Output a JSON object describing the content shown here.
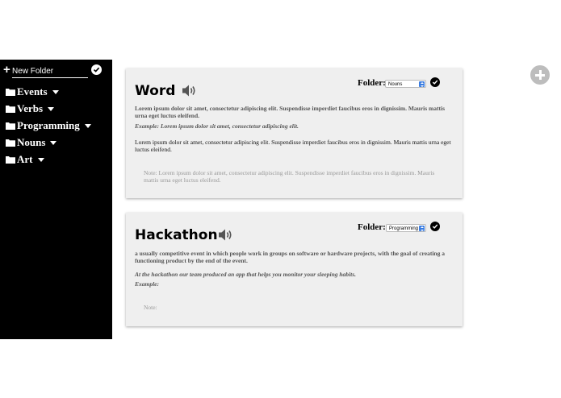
{
  "sidebar": {
    "new_folder": {
      "plus": "+",
      "placeholder": "New Folder"
    },
    "folders": [
      {
        "label": "Events"
      },
      {
        "label": "Verbs"
      },
      {
        "label": "Programming"
      },
      {
        "label": "Nouns"
      },
      {
        "label": "Art"
      }
    ]
  },
  "cards": [
    {
      "title": "Word",
      "folder_label": "Folder:",
      "folder_value": "Nouns",
      "definition": "Lorem ipsum dolor sit amet, consectetur adipiscing elit. Suspendisse imperdiet faucibus eros in dignissim. Mauris mattis urna eget luctus eleifend.",
      "example": "Example: Lorem ipsum dolor sit amet, consectetur adipiscing elit.",
      "body": "Lorem ipsum dolor sit amet, consectetur adipiscing elit. Suspendisse imperdiet faucibus eros in dignissim. Mauris mattis urna eget luctus eleifend.",
      "note": "Note: Lorem ipsum dolor sit amet, consectetur adipiscing elit. Suspendisse imperdiet faucibus eros in dignissim. Mauris mattis urna eget luctus eleifend."
    },
    {
      "title": "Hackathon",
      "folder_label": "Folder:",
      "folder_value": "Programming",
      "definition": "a usually competitive event in which people work in groups on software or hardware projects, with the goal of creating a functioning product by the end of the event.",
      "sentence": "At the hackathon our team produced an app that helps you monitor your sleeping habits.",
      "example": "Example:",
      "note": "Note:"
    }
  ],
  "icons": {
    "plus": "plus-icon",
    "check": "check-circle-icon",
    "folder": "folder-icon",
    "caret": "caret-down-icon",
    "speaker": "speaker-icon",
    "add": "add-circle-icon"
  },
  "colors": {
    "sidebar_bg": "#000000",
    "card_bg": "#efefef",
    "add_button": "#bdbdbd"
  }
}
